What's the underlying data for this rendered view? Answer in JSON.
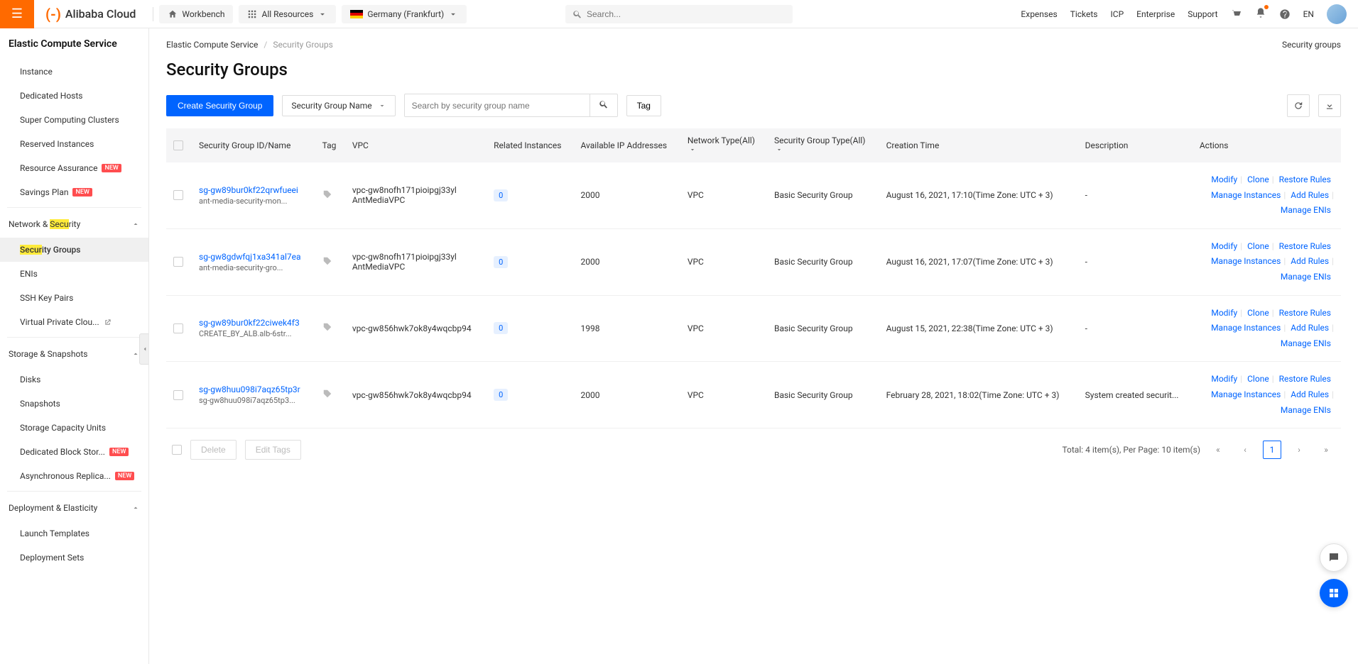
{
  "header": {
    "logo_text": "Alibaba Cloud",
    "workbench": "Workbench",
    "all_resources": "All Resources",
    "region": "Germany (Frankfurt)",
    "search_placeholder": "Search...",
    "links": {
      "expenses": "Expenses",
      "tickets": "Tickets",
      "icp": "ICP",
      "enterprise": "Enterprise",
      "support": "Support",
      "lang": "EN"
    }
  },
  "sidebar": {
    "title": "Elastic Compute Service",
    "items_top": [
      {
        "label": "Instance"
      },
      {
        "label": "Dedicated Hosts"
      },
      {
        "label": "Super Computing Clusters"
      },
      {
        "label": "Reserved Instances"
      },
      {
        "label": "Resource Assurance",
        "new": true
      },
      {
        "label": "Savings Plan",
        "new": true
      }
    ],
    "group_network": "Network & Security",
    "net_sec_hl_pre": "Network & ",
    "net_sec_hl": "Secu",
    "net_sec_after": "rity",
    "items_net": [
      {
        "label": "Security Groups",
        "active": true,
        "hl_pre": "",
        "hl": "Secur",
        "hl_post": "ity Groups"
      },
      {
        "label": "ENIs"
      },
      {
        "label": "SSH Key Pairs"
      },
      {
        "label": "Virtual Private Clou...",
        "external": true
      }
    ],
    "group_storage": "Storage & Snapshots",
    "items_storage": [
      {
        "label": "Disks"
      },
      {
        "label": "Snapshots"
      },
      {
        "label": "Storage Capacity Units"
      },
      {
        "label": "Dedicated Block Stor...",
        "new": true
      },
      {
        "label": "Asynchronous Replica...",
        "new": true
      }
    ],
    "group_deploy": "Deployment & Elasticity",
    "items_deploy": [
      {
        "label": "Launch Templates"
      },
      {
        "label": "Deployment Sets"
      }
    ]
  },
  "breadcrumb": {
    "a": "Elastic Compute Service",
    "b": "Security Groups",
    "right": "Security groups"
  },
  "page_title": "Security Groups",
  "toolbar": {
    "create": "Create Security Group",
    "filter": "Security Group Name",
    "search_placeholder": "Search by security group name",
    "tag": "Tag"
  },
  "columns": {
    "id": "Security Group ID/Name",
    "tag": "Tag",
    "vpc": "VPC",
    "related": "Related Instances",
    "ips": "Available IP Addresses",
    "nettype": "Network Type(All)",
    "sgtype": "Security Group Type(All)",
    "created": "Creation Time",
    "desc": "Description",
    "actions": "Actions"
  },
  "rows": [
    {
      "id": "sg-gw89bur0kf22qrwfueei",
      "name": "ant-media-security-mon...",
      "vpc1": "vpc-gw8nofh171pioipgj33yl",
      "vpc2": "AntMediaVPC",
      "related": "0",
      "ips": "2000",
      "net": "VPC",
      "type": "Basic Security Group",
      "created": "August 16, 2021, 17:10(Time Zone: UTC + 3)",
      "desc": "-"
    },
    {
      "id": "sg-gw8gdwfqj1xa341al7ea",
      "name": "ant-media-security-gro...",
      "vpc1": "vpc-gw8nofh171pioipgj33yl",
      "vpc2": "AntMediaVPC",
      "related": "0",
      "ips": "2000",
      "net": "VPC",
      "type": "Basic Security Group",
      "created": "August 16, 2021, 17:07(Time Zone: UTC + 3)",
      "desc": "-"
    },
    {
      "id": "sg-gw89bur0kf22ciwek4f3",
      "name": "CREATE_BY_ALB.alb-6str...",
      "vpc1": "vpc-gw856hwk7ok8y4wqcbp94",
      "vpc2": "",
      "related": "0",
      "ips": "1998",
      "net": "VPC",
      "type": "Basic Security Group",
      "created": "August 15, 2021, 22:38(Time Zone: UTC + 3)",
      "desc": "-"
    },
    {
      "id": "sg-gw8huu098i7aqz65tp3r",
      "name": "sg-gw8huu098i7aqz65tp3...",
      "vpc1": "vpc-gw856hwk7ok8y4wqcbp94",
      "vpc2": "",
      "related": "0",
      "ips": "2000",
      "net": "VPC",
      "type": "Basic Security Group",
      "created": "February 28, 2021, 18:02(Time Zone: UTC + 3)",
      "desc": "System created securit..."
    }
  ],
  "row_actions": {
    "modify": "Modify",
    "clone": "Clone",
    "restore": "Restore Rules",
    "manage_inst": "Manage Instances",
    "add_rules": "Add Rules",
    "manage_enis": "Manage ENIs"
  },
  "footer": {
    "delete": "Delete",
    "edit_tags": "Edit Tags",
    "total": "Total: 4 item(s), Per Page: 10 item(s)",
    "page": "1"
  }
}
